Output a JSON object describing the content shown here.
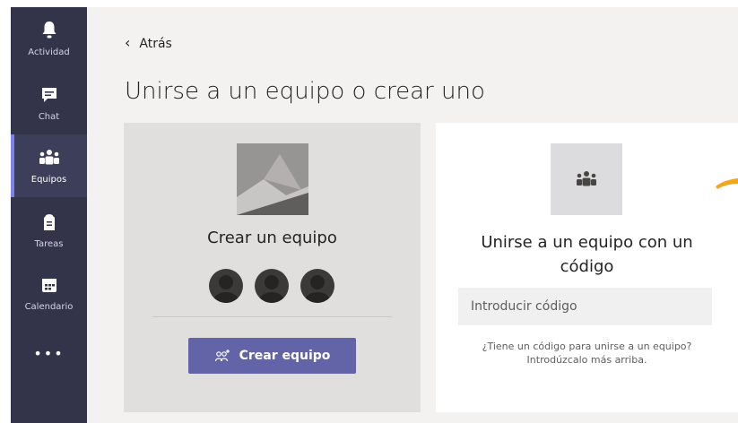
{
  "sidebar": {
    "items": [
      {
        "label": "Actividad",
        "icon": "bell-icon"
      },
      {
        "label": "Chat",
        "icon": "chat-icon"
      },
      {
        "label": "Equipos",
        "icon": "teams-icon",
        "active": true
      },
      {
        "label": "Tareas",
        "icon": "assignments-icon"
      },
      {
        "label": "Calendario",
        "icon": "calendar-icon"
      },
      {
        "label": "•••",
        "icon": "more-icon"
      }
    ]
  },
  "header": {
    "back_label": "Atrás",
    "title": "Unirse a un equipo o crear uno"
  },
  "create_card": {
    "title": "Crear un equipo",
    "button_label": "Crear equipo"
  },
  "join_card": {
    "title": "Unirse a un equipo con un código",
    "input_placeholder": "Introducir código",
    "hint_line1": "¿Tiene un código para unirse a un equipo?",
    "hint_line2": "Introdúzcalo más arriba."
  },
  "colors": {
    "sidebar_bg": "#33344a",
    "accent": "#6264a7",
    "highlight": "#f3a51f"
  }
}
